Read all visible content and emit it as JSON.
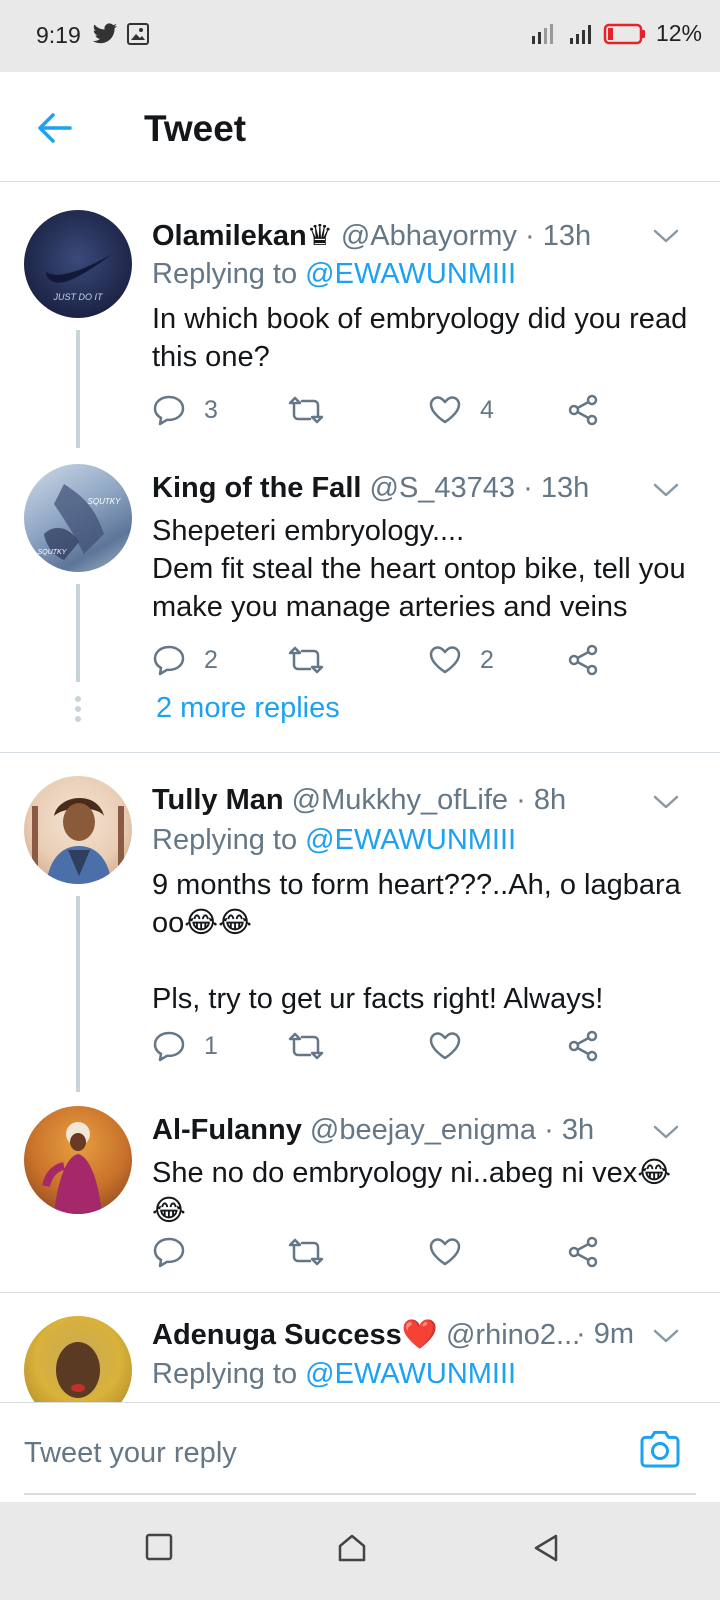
{
  "status_bar": {
    "time": "9:19",
    "battery": "12%"
  },
  "header": {
    "title": "Tweet"
  },
  "tweets": [
    {
      "name": "Olamilekan♛",
      "handle": "@Abhayormy",
      "time": "· 13h",
      "replying_label": "Replying to",
      "replying_to": "@EWAWUNMIII",
      "text": "In which book of embryology did you read this one?",
      "reply_count": "3",
      "retweet_count": "",
      "like_count": "4",
      "avatar_text": "JUST DO IT"
    },
    {
      "name": "King of the Fall",
      "handle": "@S_43743",
      "time": "· 13h",
      "text": "Shepeteri embryology....\nDem fit steal the heart ontop bike, tell you make you manage arteries and veins",
      "reply_count": "2",
      "retweet_count": "",
      "like_count": "2",
      "avatar_text": "SQUTKY"
    },
    {
      "name": "Tully Man",
      "handle": "@Mukkhy_ofLife",
      "time": "· 8h",
      "replying_label": "Replying to",
      "replying_to": "@EWAWUNMIII",
      "text": "9 months to form  heart???..Ah, o lagbara oo😂😂\n\nPls, try to get ur facts right! Always!",
      "reply_count": "1",
      "retweet_count": "",
      "like_count": ""
    },
    {
      "name": "Al-Fulanny",
      "handle": "@beejay_enigma",
      "time": "· 3h",
      "text": "She no do embryology ni..abeg ni vex😂\n😂",
      "reply_count": "",
      "retweet_count": "",
      "like_count": ""
    },
    {
      "name": "Adenuga Success❤️",
      "handle": "@rhino2...",
      "time": "· 9m",
      "replying_label": "Replying to",
      "replying_to": "@EWAWUNMIII"
    }
  ],
  "more_replies": "2 more replies",
  "reply_bar": {
    "placeholder": "Tweet your reply"
  },
  "colors": {
    "accent": "#1da1f2",
    "muted": "#657786",
    "thread_line": "#c9d3da"
  },
  "icons": [
    "back-arrow-icon",
    "twitter-icon",
    "gallery-icon",
    "signal-icon",
    "battery-icon",
    "reply-icon",
    "retweet-icon",
    "like-icon",
    "share-icon",
    "chevron-down-icon",
    "camera-icon",
    "nav-recents-icon",
    "nav-home-icon",
    "nav-back-icon"
  ]
}
